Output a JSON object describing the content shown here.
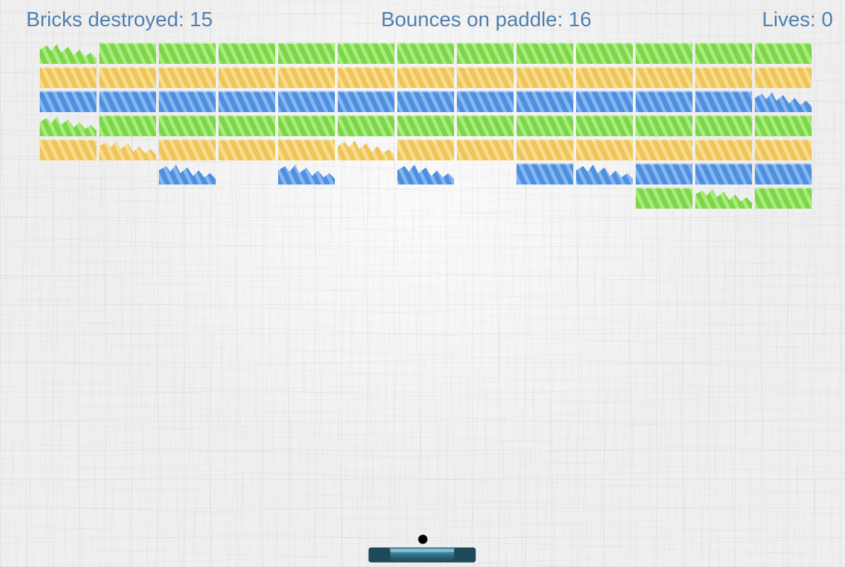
{
  "hud": {
    "bricks_destroyed": "Bricks destroyed: 15",
    "bounces_on_paddle": "Bounces on paddle: 16",
    "lives": "Lives: 0"
  },
  "colors": {
    "hud_text": "#4f7fae",
    "green": "#7dd64a",
    "yellow": "#efc55a",
    "blue": "#4f8fe0",
    "paddle": "#2f6f84",
    "ball": "#000000"
  },
  "bricks": {
    "columns": 13,
    "row_colors": [
      "green",
      "yellow",
      "blue",
      "green",
      "yellow",
      "blue",
      "green"
    ],
    "legend": "state codes: 1 = intact, 2 = cracked, 0 = destroyed",
    "grid": [
      [
        2,
        1,
        1,
        1,
        1,
        1,
        1,
        1,
        1,
        1,
        1,
        1,
        1
      ],
      [
        1,
        1,
        1,
        1,
        1,
        1,
        1,
        1,
        1,
        1,
        1,
        1,
        1
      ],
      [
        1,
        1,
        1,
        1,
        1,
        1,
        1,
        1,
        1,
        1,
        1,
        1,
        2
      ],
      [
        2,
        1,
        1,
        1,
        1,
        1,
        1,
        1,
        1,
        1,
        1,
        1,
        1
      ],
      [
        1,
        2,
        1,
        1,
        1,
        2,
        1,
        1,
        1,
        1,
        1,
        1,
        1
      ],
      [
        0,
        0,
        2,
        0,
        2,
        0,
        2,
        0,
        1,
        2,
        1,
        1,
        1
      ],
      [
        0,
        0,
        0,
        0,
        0,
        0,
        0,
        0,
        0,
        0,
        1,
        2,
        1
      ]
    ]
  },
  "ball": {
    "visible": true
  },
  "paddle": {
    "visible": true
  }
}
